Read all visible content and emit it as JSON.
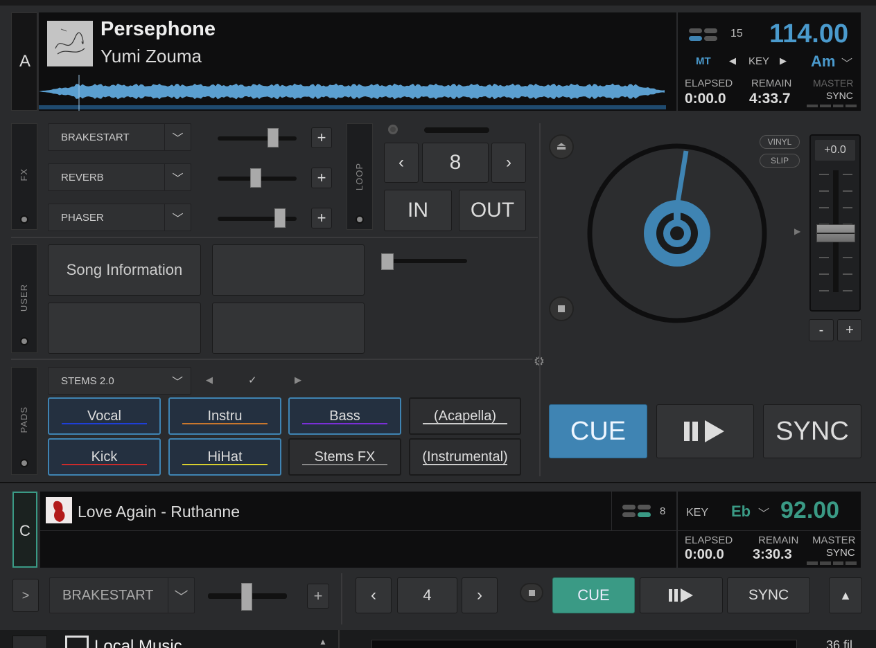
{
  "deckA": {
    "letter": "A",
    "title": "Persephone",
    "artist": "Yumi Zouma",
    "beat_count": "15",
    "bpm": "114.00",
    "mt": "MT",
    "key_label": "KEY",
    "key_value": "Am",
    "elapsed_label": "ELAPSED",
    "elapsed": "0:00.0",
    "remain_label": "REMAIN",
    "remain": "4:33.7",
    "master": "MASTER",
    "sync": "SYNC",
    "fx_label": "FX",
    "fx": [
      {
        "name": "BRAKESTART",
        "level": 0.8
      },
      {
        "name": "REVERB",
        "level": 0.55
      },
      {
        "name": "PHASER",
        "level": 0.9
      }
    ],
    "loop_label": "LOOP",
    "loop_size": "8",
    "loop_in": "IN",
    "loop_out": "OUT",
    "user_label": "USER",
    "user_pads": [
      "Song Information",
      "",
      "",
      ""
    ],
    "vinyl": "VINYL",
    "slip": "SLIP",
    "pitch": "+0.0",
    "pitch_minus": "-",
    "pitch_plus": "+",
    "pads_label": "PADS",
    "pads_mode": "STEMS 2.0",
    "pads": [
      {
        "label": "Vocal",
        "color": "#1e3fd8",
        "active": true
      },
      {
        "label": "Instru",
        "color": "#c9772d",
        "active": true
      },
      {
        "label": "Bass",
        "color": "#7a2fd8",
        "active": true
      },
      {
        "label": "(Acapella)",
        "color": "#cccccc",
        "active": false
      },
      {
        "label": "Kick",
        "color": "#cc2b2b",
        "active": true
      },
      {
        "label": "HiHat",
        "color": "#d8d02e",
        "active": true
      },
      {
        "label": "Stems FX",
        "color": "#888888",
        "active": false
      },
      {
        "label": "(Instrumental)",
        "color": "#cccccc",
        "active": false
      }
    ],
    "cue": "CUE",
    "sync_btn": "SYNC",
    "accent": "#3f84b3"
  },
  "deckC": {
    "letter": "C",
    "track": "Love Again - Ruthanne",
    "beat_count": "8",
    "key_label": "KEY",
    "key_value": "Eb",
    "bpm": "92.00",
    "elapsed_label": "ELAPSED",
    "elapsed": "0:00.0",
    "remain_label": "REMAIN",
    "remain": "3:30.3",
    "master": "MASTER",
    "sync": "SYNC",
    "expand": ">",
    "fx_name": "BRAKESTART",
    "loop_size": "4",
    "cue": "CUE",
    "sync_btn": "SYNC",
    "accent": "#3a9a85"
  },
  "browser": {
    "folder": "Local Music",
    "files": "36 fil"
  }
}
